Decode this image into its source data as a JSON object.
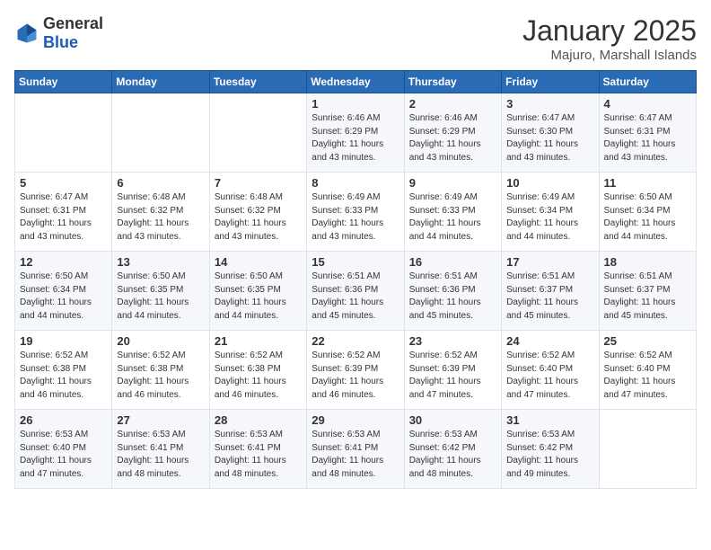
{
  "header": {
    "logo_general": "General",
    "logo_blue": "Blue",
    "title": "January 2025",
    "subtitle": "Majuro, Marshall Islands"
  },
  "weekdays": [
    "Sunday",
    "Monday",
    "Tuesday",
    "Wednesday",
    "Thursday",
    "Friday",
    "Saturday"
  ],
  "weeks": [
    [
      {
        "day": "",
        "info": ""
      },
      {
        "day": "",
        "info": ""
      },
      {
        "day": "",
        "info": ""
      },
      {
        "day": "1",
        "info": "Sunrise: 6:46 AM\nSunset: 6:29 PM\nDaylight: 11 hours\nand 43 minutes."
      },
      {
        "day": "2",
        "info": "Sunrise: 6:46 AM\nSunset: 6:29 PM\nDaylight: 11 hours\nand 43 minutes."
      },
      {
        "day": "3",
        "info": "Sunrise: 6:47 AM\nSunset: 6:30 PM\nDaylight: 11 hours\nand 43 minutes."
      },
      {
        "day": "4",
        "info": "Sunrise: 6:47 AM\nSunset: 6:31 PM\nDaylight: 11 hours\nand 43 minutes."
      }
    ],
    [
      {
        "day": "5",
        "info": "Sunrise: 6:47 AM\nSunset: 6:31 PM\nDaylight: 11 hours\nand 43 minutes."
      },
      {
        "day": "6",
        "info": "Sunrise: 6:48 AM\nSunset: 6:32 PM\nDaylight: 11 hours\nand 43 minutes."
      },
      {
        "day": "7",
        "info": "Sunrise: 6:48 AM\nSunset: 6:32 PM\nDaylight: 11 hours\nand 43 minutes."
      },
      {
        "day": "8",
        "info": "Sunrise: 6:49 AM\nSunset: 6:33 PM\nDaylight: 11 hours\nand 43 minutes."
      },
      {
        "day": "9",
        "info": "Sunrise: 6:49 AM\nSunset: 6:33 PM\nDaylight: 11 hours\nand 44 minutes."
      },
      {
        "day": "10",
        "info": "Sunrise: 6:49 AM\nSunset: 6:34 PM\nDaylight: 11 hours\nand 44 minutes."
      },
      {
        "day": "11",
        "info": "Sunrise: 6:50 AM\nSunset: 6:34 PM\nDaylight: 11 hours\nand 44 minutes."
      }
    ],
    [
      {
        "day": "12",
        "info": "Sunrise: 6:50 AM\nSunset: 6:34 PM\nDaylight: 11 hours\nand 44 minutes."
      },
      {
        "day": "13",
        "info": "Sunrise: 6:50 AM\nSunset: 6:35 PM\nDaylight: 11 hours\nand 44 minutes."
      },
      {
        "day": "14",
        "info": "Sunrise: 6:50 AM\nSunset: 6:35 PM\nDaylight: 11 hours\nand 44 minutes."
      },
      {
        "day": "15",
        "info": "Sunrise: 6:51 AM\nSunset: 6:36 PM\nDaylight: 11 hours\nand 45 minutes."
      },
      {
        "day": "16",
        "info": "Sunrise: 6:51 AM\nSunset: 6:36 PM\nDaylight: 11 hours\nand 45 minutes."
      },
      {
        "day": "17",
        "info": "Sunrise: 6:51 AM\nSunset: 6:37 PM\nDaylight: 11 hours\nand 45 minutes."
      },
      {
        "day": "18",
        "info": "Sunrise: 6:51 AM\nSunset: 6:37 PM\nDaylight: 11 hours\nand 45 minutes."
      }
    ],
    [
      {
        "day": "19",
        "info": "Sunrise: 6:52 AM\nSunset: 6:38 PM\nDaylight: 11 hours\nand 46 minutes."
      },
      {
        "day": "20",
        "info": "Sunrise: 6:52 AM\nSunset: 6:38 PM\nDaylight: 11 hours\nand 46 minutes."
      },
      {
        "day": "21",
        "info": "Sunrise: 6:52 AM\nSunset: 6:38 PM\nDaylight: 11 hours\nand 46 minutes."
      },
      {
        "day": "22",
        "info": "Sunrise: 6:52 AM\nSunset: 6:39 PM\nDaylight: 11 hours\nand 46 minutes."
      },
      {
        "day": "23",
        "info": "Sunrise: 6:52 AM\nSunset: 6:39 PM\nDaylight: 11 hours\nand 47 minutes."
      },
      {
        "day": "24",
        "info": "Sunrise: 6:52 AM\nSunset: 6:40 PM\nDaylight: 11 hours\nand 47 minutes."
      },
      {
        "day": "25",
        "info": "Sunrise: 6:52 AM\nSunset: 6:40 PM\nDaylight: 11 hours\nand 47 minutes."
      }
    ],
    [
      {
        "day": "26",
        "info": "Sunrise: 6:53 AM\nSunset: 6:40 PM\nDaylight: 11 hours\nand 47 minutes."
      },
      {
        "day": "27",
        "info": "Sunrise: 6:53 AM\nSunset: 6:41 PM\nDaylight: 11 hours\nand 48 minutes."
      },
      {
        "day": "28",
        "info": "Sunrise: 6:53 AM\nSunset: 6:41 PM\nDaylight: 11 hours\nand 48 minutes."
      },
      {
        "day": "29",
        "info": "Sunrise: 6:53 AM\nSunset: 6:41 PM\nDaylight: 11 hours\nand 48 minutes."
      },
      {
        "day": "30",
        "info": "Sunrise: 6:53 AM\nSunset: 6:42 PM\nDaylight: 11 hours\nand 48 minutes."
      },
      {
        "day": "31",
        "info": "Sunrise: 6:53 AM\nSunset: 6:42 PM\nDaylight: 11 hours\nand 49 minutes."
      },
      {
        "day": "",
        "info": ""
      }
    ]
  ]
}
